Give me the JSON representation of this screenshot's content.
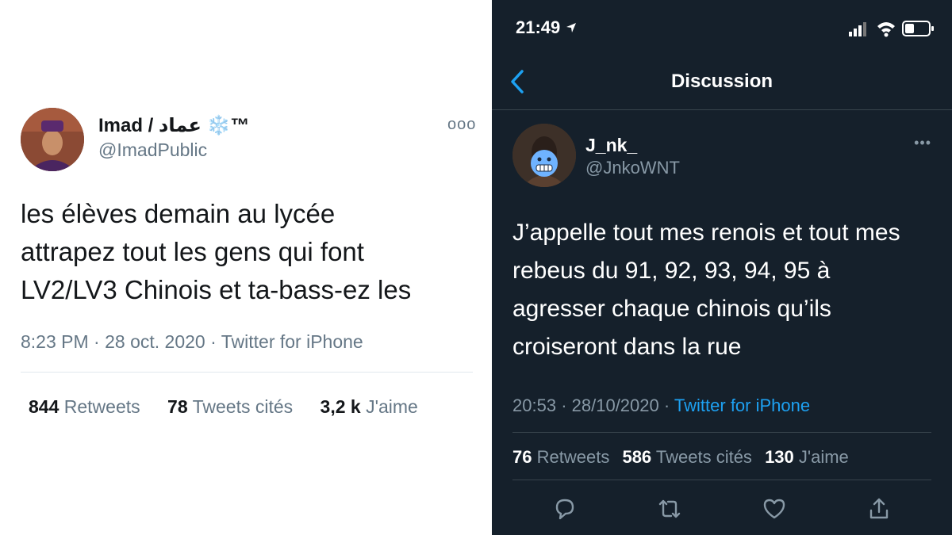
{
  "left_tweet": {
    "display_name": "Imad / عماد ❄️™",
    "handle": "@ImadPublic",
    "more": "ooo",
    "text_lines": [
      "les élèves demain au lycée",
      "attrapez tout les gens qui font",
      "LV2/LV3 Chinois et ta-bass-ez les"
    ],
    "time": "8:23 PM",
    "date": "28 oct. 2020",
    "source": "Twitter for iPhone",
    "stats": {
      "retweets_count": "844",
      "retweets_label": "Retweets",
      "quotes_count": "78",
      "quotes_label": "Tweets cités",
      "likes_count": "3,2 k",
      "likes_label": "J'aime"
    }
  },
  "right_screen": {
    "status_bar": {
      "time": "21:49",
      "location_icon": "location-arrow-icon"
    },
    "header": {
      "title": "Discussion",
      "back_icon": "chevron-left-icon"
    },
    "tweet": {
      "display_name": "J_nk_",
      "handle": "@JnkoWNT",
      "more": "•••",
      "text_lines": [
        "J’appelle tout mes renois et tout mes",
        "rebeus du 91, 92, 93, 94, 95 à",
        "agresser chaque chinois qu’ils",
        "croiseront dans la rue"
      ],
      "time": "20:53",
      "date": "28/10/2020",
      "source": "Twitter for iPhone",
      "stats": {
        "retweets_count": "76",
        "retweets_label": "Retweets",
        "quotes_count": "586",
        "quotes_label": "Tweets cités",
        "likes_count": "130",
        "likes_label": "J'aime"
      }
    },
    "actions": [
      "reply-icon",
      "retweet-icon",
      "like-icon",
      "share-icon"
    ]
  },
  "colors": {
    "light_bg": "#ffffff",
    "light_text": "#14171a",
    "light_muted": "#657786",
    "dark_bg": "#15202b",
    "dark_muted": "#8899a6",
    "link_blue": "#1da1f2"
  }
}
